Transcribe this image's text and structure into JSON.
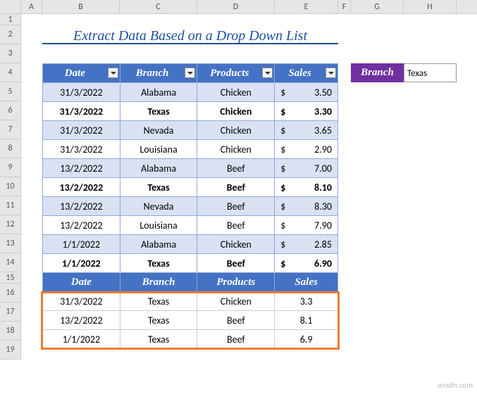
{
  "columns": [
    "A",
    "B",
    "C",
    "D",
    "E",
    "F",
    "G",
    "H"
  ],
  "rows": [
    "1",
    "2",
    "3",
    "4",
    "5",
    "6",
    "7",
    "8",
    "9",
    "10",
    "11",
    "12",
    "13",
    "14",
    "15",
    "16",
    "17",
    "18",
    "19"
  ],
  "title": "Extract Data Based on a Drop Down List",
  "headers": {
    "date": "Date",
    "branch": "Branch",
    "products": "Products",
    "sales": "Sales"
  },
  "main_data": [
    {
      "date": "31/3/2022",
      "branch": "Alabama",
      "products": "Chicken",
      "currency": "$",
      "sales": "3.50",
      "bold": false
    },
    {
      "date": "31/3/2022",
      "branch": "Texas",
      "products": "Chicken",
      "currency": "$",
      "sales": "3.30",
      "bold": true
    },
    {
      "date": "31/3/2022",
      "branch": "Nevada",
      "products": "Chicken",
      "currency": "$",
      "sales": "3.65",
      "bold": false
    },
    {
      "date": "31/3/2022",
      "branch": "Louisiana",
      "products": "Chicken",
      "currency": "$",
      "sales": "2.90",
      "bold": false
    },
    {
      "date": "13/2/2022",
      "branch": "Alabama",
      "products": "Beef",
      "currency": "$",
      "sales": "7.00",
      "bold": false
    },
    {
      "date": "13/2/2022",
      "branch": "Texas",
      "products": "Beef",
      "currency": "$",
      "sales": "8.10",
      "bold": true
    },
    {
      "date": "13/2/2022",
      "branch": "Nevada",
      "products": "Beef",
      "currency": "$",
      "sales": "8.30",
      "bold": false
    },
    {
      "date": "13/2/2022",
      "branch": "Louisiana",
      "products": "Beef",
      "currency": "$",
      "sales": "7.90",
      "bold": false
    },
    {
      "date": "1/1/2022",
      "branch": "Alabama",
      "products": "Chicken",
      "currency": "$",
      "sales": "2.85",
      "bold": false
    },
    {
      "date": "1/1/2022",
      "branch": "Texas",
      "products": "Beef",
      "currency": "$",
      "sales": "6.90",
      "bold": true
    }
  ],
  "lookup": {
    "label": "Branch",
    "value": "Texas"
  },
  "result_headers": {
    "date": "Date",
    "branch": "Branch",
    "products": "Products",
    "sales": "Sales"
  },
  "result_data": [
    {
      "date": "31/3/2022",
      "branch": "Texas",
      "products": "Chicken",
      "sales": "3.3"
    },
    {
      "date": "13/2/2022",
      "branch": "Texas",
      "products": "Beef",
      "sales": "8.1"
    },
    {
      "date": "1/1/2022",
      "branch": "Texas",
      "products": "Beef",
      "sales": "6.9"
    }
  ],
  "watermark": "wsxdn.com"
}
